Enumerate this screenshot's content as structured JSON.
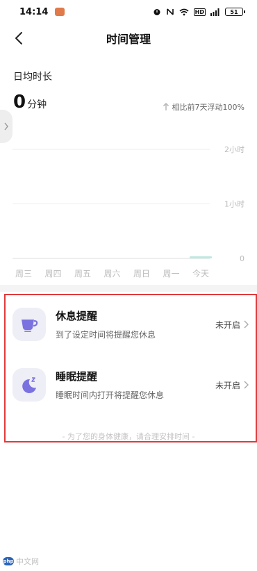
{
  "status_bar": {
    "time": "14:14",
    "signal": "5G",
    "battery": "51"
  },
  "header": {
    "title": "时间管理"
  },
  "stats": {
    "label": "日均时长",
    "value": "0",
    "unit": "分钟",
    "compare_text": "相比前7天浮动100%"
  },
  "chart_data": {
    "type": "bar",
    "categories": [
      "周三",
      "周四",
      "周五",
      "周六",
      "周日",
      "周一",
      "今天"
    ],
    "values": [
      0,
      0,
      0,
      0,
      0,
      0,
      0.02
    ],
    "y_ticks": [
      "2小时",
      "1小时",
      "0"
    ],
    "y_tick_values": [
      2,
      1,
      0
    ],
    "ylim": [
      0,
      2
    ],
    "title": "",
    "xlabel": "",
    "ylabel": "",
    "grid": true,
    "bar_color": "#bfe8e0"
  },
  "reminders": [
    {
      "title": "休息提醒",
      "desc": "到了设定时间将提醒您休息",
      "status": "未开启",
      "icon": "cup-icon"
    },
    {
      "title": "睡眠提醒",
      "desc": "睡眠时间内打开将提醒您休息",
      "status": "未开启",
      "icon": "moon-icon"
    }
  ],
  "footer_tip": "- 为了您的身体健康，请合理安排时间 -",
  "watermark": {
    "logo": "php",
    "text": "中文网"
  },
  "colors": {
    "accent_icon": "#7b72e0",
    "highlight": "#e03a3a"
  }
}
